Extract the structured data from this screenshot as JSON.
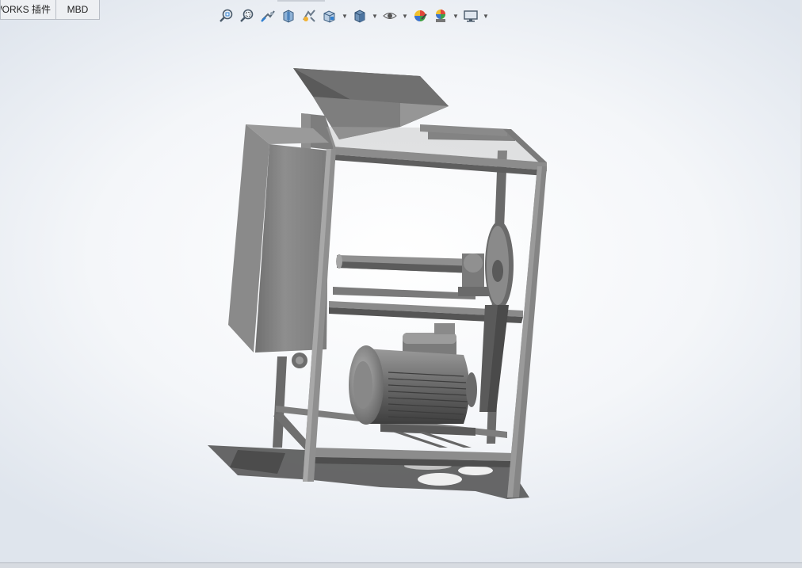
{
  "tabs": [
    {
      "label": "SOLIDWORKS 插件"
    },
    {
      "label": "MBD"
    }
  ],
  "heads_up_toolbar": [
    {
      "icon": "zoom-to-fit-icon"
    },
    {
      "icon": "zoom-to-area-icon"
    },
    {
      "icon": "previous-view-icon"
    },
    {
      "icon": "section-view-icon"
    },
    {
      "icon": "dynamic-annotation-views-icon"
    },
    {
      "icon": "view-orientation-icon"
    },
    {
      "icon": "display-style-icon"
    },
    {
      "icon": "hide-show-items-icon"
    },
    {
      "icon": "edit-appearance-icon"
    },
    {
      "icon": "apply-scene-icon"
    },
    {
      "icon": "view-settings-icon"
    }
  ],
  "model": {
    "description_colors": {
      "steel": "#8a8a8a",
      "dark": "#4f4f4f",
      "light": "#a9a9a9"
    }
  }
}
